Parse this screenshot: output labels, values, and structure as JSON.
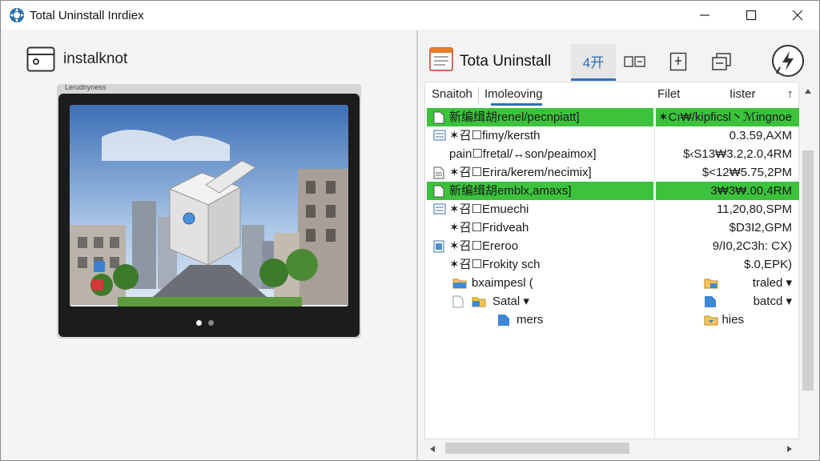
{
  "window": {
    "title": "Total Uninstall Inrdiex",
    "accent_color": "#2f6fb5",
    "highlight_color": "#3cc23c"
  },
  "left_panel": {
    "header_label": "instalknot",
    "preview_caption": "Lerudnyness",
    "carousel_dots": 2,
    "carousel_active_index": 0
  },
  "toolbar": {
    "app_title": "Tota Uninstall",
    "active_tab_label": "4开",
    "icons": [
      "rename-icon",
      "export-icon",
      "duplicate-icon",
      "help-flash-icon"
    ]
  },
  "list": {
    "columns": [
      "Snaitoh",
      "Imoleoving",
      "Filet",
      "Iister"
    ],
    "rows": [
      {
        "icon": "file-icon",
        "name": "新编缉胡renel/pecnpiatt]",
        "date": "✶Cı₩/kipficsl丶ℳingnoe",
        "selected": true
      },
      {
        "icon": "list-icon",
        "name": "✶召☐fimy/kersth",
        "date": "0.3.59,AXM",
        "selected": false
      },
      {
        "icon": "none",
        "name": "pain☐fretal/↔son/peaimox]",
        "date": "$‹S13₩3.2,2.0,4RM",
        "selected": false
      },
      {
        "icon": "doc-icon",
        "name": "✶召☐Erira/kerem/necimix]",
        "date": "$<12₩5.75,2PM",
        "selected": false
      },
      {
        "icon": "file-icon",
        "name": "新编缉胡emblx,amaxs]",
        "date": "3₩3₩.00,4RM",
        "selected": true
      },
      {
        "icon": "list-icon",
        "name": "✶召☐Emuechi",
        "date": "11,20,80,SPM",
        "selected": false
      },
      {
        "icon": "none",
        "name": "✶召☐Fridveah",
        "date": "$D3I2,GPM",
        "selected": false
      },
      {
        "icon": "doc-blue-icon",
        "name": "✶召☐Ereroo",
        "date": "9/I0,2C3h: CX)",
        "selected": false
      },
      {
        "icon": "none",
        "name": "✶召☐Frokity sch",
        "date": "$.0,EPK)",
        "selected": false
      },
      {
        "icon": "folder-blue-icon",
        "name": "bxaimpesl (",
        "date": "traled ▾",
        "selected": false
      },
      {
        "icon": "folder-icon",
        "name": "Satal ▾",
        "date": "batcd ▾",
        "selected": false
      },
      {
        "icon": "doc-blue-icon",
        "name": "mers",
        "date": "hies",
        "selected": false
      }
    ]
  }
}
